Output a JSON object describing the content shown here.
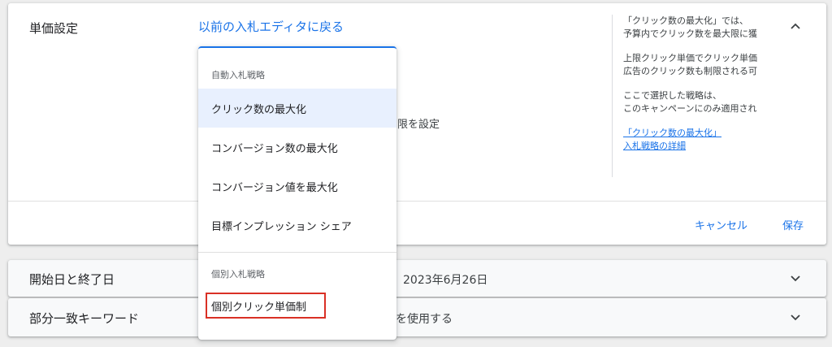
{
  "bid_section": {
    "title": "単価設定",
    "back_link": "以前の入札エディタに戻る",
    "limit_text": "限を設定",
    "help": {
      "para1_line1": "「クリック数の最大化」では、",
      "para1_line2": "予算内でクリック数を最大限に獲",
      "para2_line1": "上限クリック単価でクリック単価",
      "para2_line2": "広告のクリック数も制限される可",
      "para3_line1": "ここで選択した戦略は、",
      "para3_line2": "このキャンペーンにのみ適用され",
      "link_line1": "「クリック数の最大化」",
      "link_line2": "入札戦略の詳細"
    },
    "cancel_label": "キャンセル",
    "save_label": "保存"
  },
  "dropdown": {
    "auto_group_label": "自動入札戦略",
    "auto_options": [
      "クリック数の最大化",
      "コンバージョン数の最大化",
      "コンバージョン値を最大化",
      "目標インプレッション シェア"
    ],
    "selected_option": "クリック数の最大化",
    "manual_group_label": "個別入札戦略",
    "manual_options": [
      "個別クリック単価制"
    ],
    "highlighted_option": "個別クリック単価制",
    "highlight_color": "#d93025"
  },
  "dates_section": {
    "title": "開始日と終了日",
    "value": "：2023年6月26日"
  },
  "match_section": {
    "title": "部分一致キーワード",
    "value": "を使用する"
  },
  "colors": {
    "accent": "#1a73e8",
    "selected_bg": "#e8f0fe",
    "page_bg": "#eeeeee"
  }
}
